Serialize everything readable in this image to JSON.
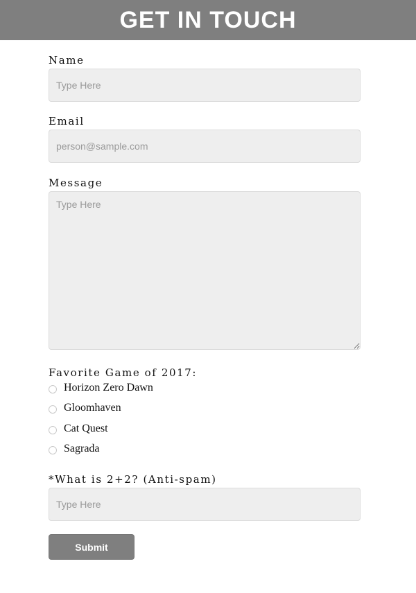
{
  "header": {
    "title": "GET IN TOUCH"
  },
  "form": {
    "name": {
      "label": "Name",
      "placeholder": "Type Here",
      "value": ""
    },
    "email": {
      "label": "Email",
      "placeholder": "person@sample.com",
      "value": ""
    },
    "message": {
      "label": "Message",
      "placeholder": "Type Here",
      "value": ""
    },
    "favorite_game": {
      "label": "Favorite Game of 2017:",
      "options": [
        {
          "label": "Horizon Zero Dawn",
          "selected": false
        },
        {
          "label": "Gloomhaven",
          "selected": false
        },
        {
          "label": "Cat Quest",
          "selected": false
        },
        {
          "label": "Sagrada",
          "selected": false
        }
      ]
    },
    "antispam": {
      "label": "*What is 2+2? (Anti-spam)",
      "placeholder": "Type Here",
      "value": ""
    },
    "submit_label": "Submit"
  },
  "colors": {
    "header_bg": "#7f7f7f",
    "field_bg": "#eeeeee",
    "button_bg": "#7f7f7f"
  }
}
